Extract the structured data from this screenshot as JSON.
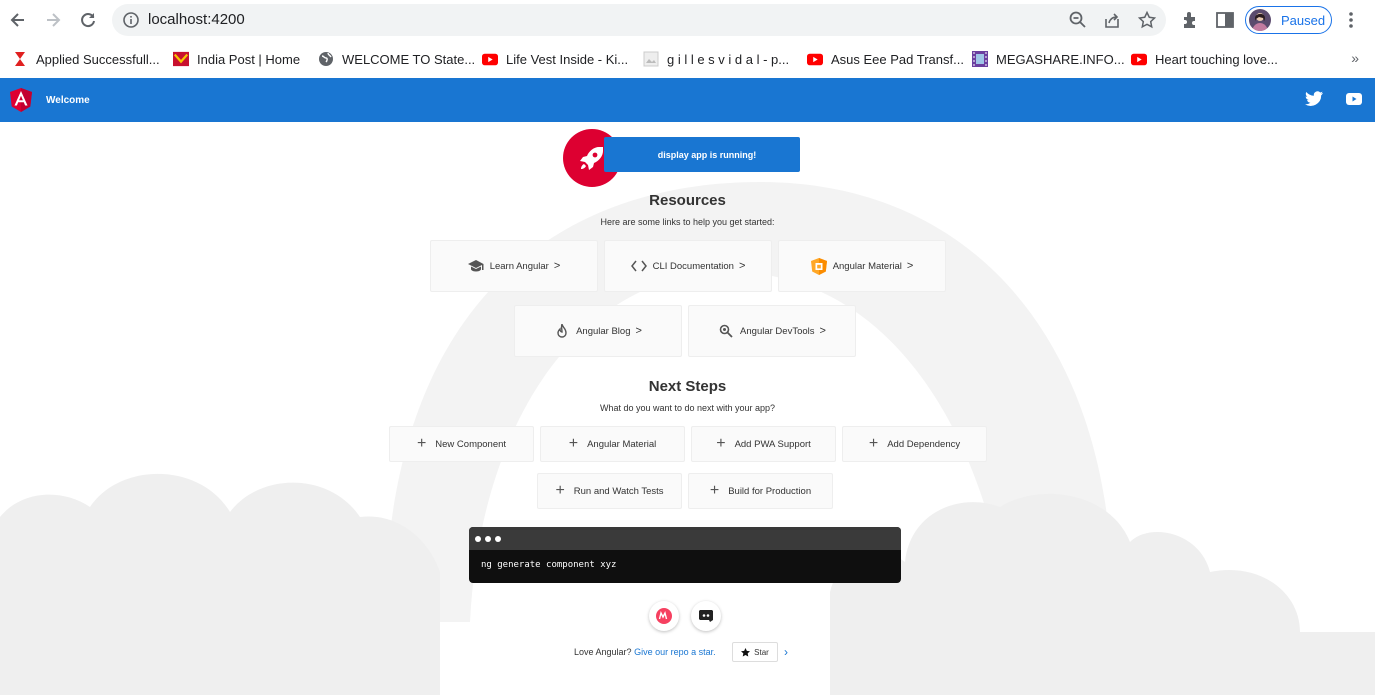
{
  "browser": {
    "url": "localhost:4200",
    "profile_label": "Paused",
    "bookmarks": [
      {
        "label": "Applied Successfull...",
        "icon": "hourglass-red-icon"
      },
      {
        "label": "India Post | Home",
        "icon": "india-post-icon"
      },
      {
        "label": "WELCOME TO State...",
        "icon": "globe-icon"
      },
      {
        "label": "Life Vest Inside - Ki...",
        "icon": "youtube-icon"
      },
      {
        "label": "g i l l e s v i d a l - p...",
        "icon": "image-icon"
      },
      {
        "label": "Asus Eee Pad Transf...",
        "icon": "youtube-icon"
      },
      {
        "label": "MEGASHARE.INFO...",
        "icon": "film-icon"
      },
      {
        "label": "Heart touching love...",
        "icon": "youtube-icon"
      }
    ],
    "more_label": "»"
  },
  "app": {
    "title": "Welcome",
    "running_label": "display app is running!",
    "resources_title": "Resources",
    "resources_subtitle": "Here are some links to help you get started:",
    "resources": [
      {
        "label": "Learn Angular",
        "icon": "graduation-cap-icon"
      },
      {
        "label": "CLI Documentation",
        "icon": "code-brackets-icon"
      },
      {
        "label": "Angular Material",
        "icon": "angular-material-icon"
      },
      {
        "label": "Angular Blog",
        "icon": "flame-icon"
      },
      {
        "label": "Angular DevTools",
        "icon": "magnifier-icon"
      }
    ],
    "next_title": "Next Steps",
    "next_subtitle": "What do you want to do next with your app?",
    "steps": [
      {
        "label": "New Component"
      },
      {
        "label": "Angular Material"
      },
      {
        "label": "Add PWA Support"
      },
      {
        "label": "Add Dependency"
      },
      {
        "label": "Run and Watch Tests"
      },
      {
        "label": "Build for Production"
      }
    ],
    "terminal_command": "ng generate component xyz",
    "love_text": "Love Angular?",
    "love_link": "Give our repo a star.",
    "star_label": "Star",
    "star_chevron": "›"
  },
  "colors": {
    "angular_red": "#dd0031",
    "toolbar_blue": "#1976d2",
    "material_orange": "#ffa726"
  }
}
